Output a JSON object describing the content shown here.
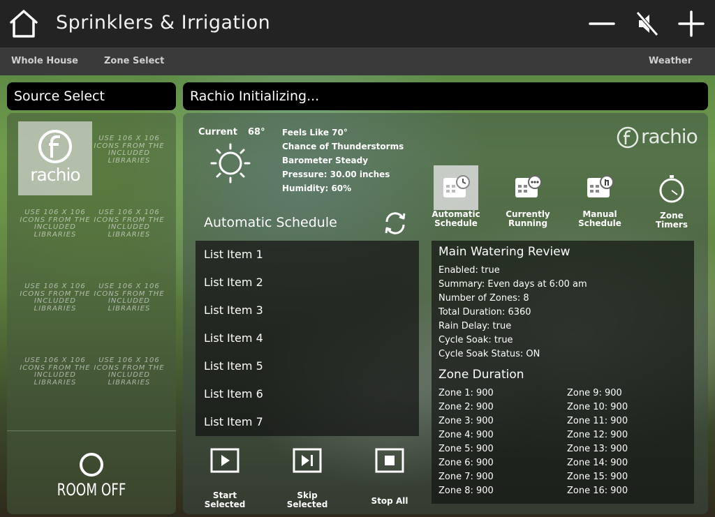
{
  "header": {
    "title": "Sprinklers & Irrigation",
    "icons": [
      "home-icon",
      "volume-down-icon",
      "mute-icon",
      "volume-up-icon"
    ]
  },
  "nav": {
    "whole_house": "Whole House",
    "zone_select": "Zone Select",
    "weather": "Weather"
  },
  "source_select": {
    "title": "Source Select",
    "active_source": "rachio",
    "placeholder": "USE 106 X 106 ICONS FROM THE INCLUDED LIBRARIES",
    "room_off": "ROOM OFF"
  },
  "main": {
    "title": "Rachio  Initializing...",
    "brand": "rachio",
    "weather": {
      "current_label": "Current",
      "current_temp": "68°",
      "feels_like": "Feels Like 70°",
      "forecast": "Chance of Thunderstorms",
      "barometer": "Barometer Steady",
      "pressure": "Pressure: 30.00 inches",
      "humidity": "Humidity: 60%",
      "icon": "sun-icon"
    },
    "schedule_title": "Automatic Schedule",
    "list_items": [
      "List Item 1",
      "List Item 2",
      "List Item 3",
      "List Item 4",
      "List Item 5",
      "List Item 6",
      "List Item 7"
    ],
    "modes": [
      {
        "label1": "Automatic",
        "label2": "Schedule"
      },
      {
        "label1": "Currently",
        "label2": "Running"
      },
      {
        "label1": "Manual",
        "label2": "Schedule"
      },
      {
        "label1": "Zone",
        "label2": "Timers"
      }
    ],
    "active_mode": "Automatic Schedule",
    "review": {
      "title": "Main Watering Review",
      "lines": [
        "Enabled: true",
        "Summary: Even days at 6:00 am",
        "Number of Zones: 8",
        "Total Duration: 6360",
        "Rain Delay: true",
        "Cycle Soak: true",
        "Cycle Soak Status: ON"
      ],
      "zone_title": "Zone Duration",
      "zones": [
        "Zone 1: 900",
        "Zone 2: 900",
        "Zone 3: 900",
        "Zone 4: 900",
        "Zone 5: 900",
        "Zone 6: 900",
        "Zone 7: 900",
        "Zone 8: 900",
        "Zone 9: 900",
        "Zone 10: 900",
        "Zone 11: 900",
        "Zone 12: 900",
        "Zone 13: 900",
        "Zone 14: 900",
        "Zone 15: 900",
        "Zone 16: 900"
      ]
    },
    "transport": [
      {
        "label1": "Start",
        "label2": "Selected"
      },
      {
        "label1": "Skip",
        "label2": "Selected"
      },
      {
        "label1": "Stop All",
        "label2": ""
      }
    ]
  }
}
